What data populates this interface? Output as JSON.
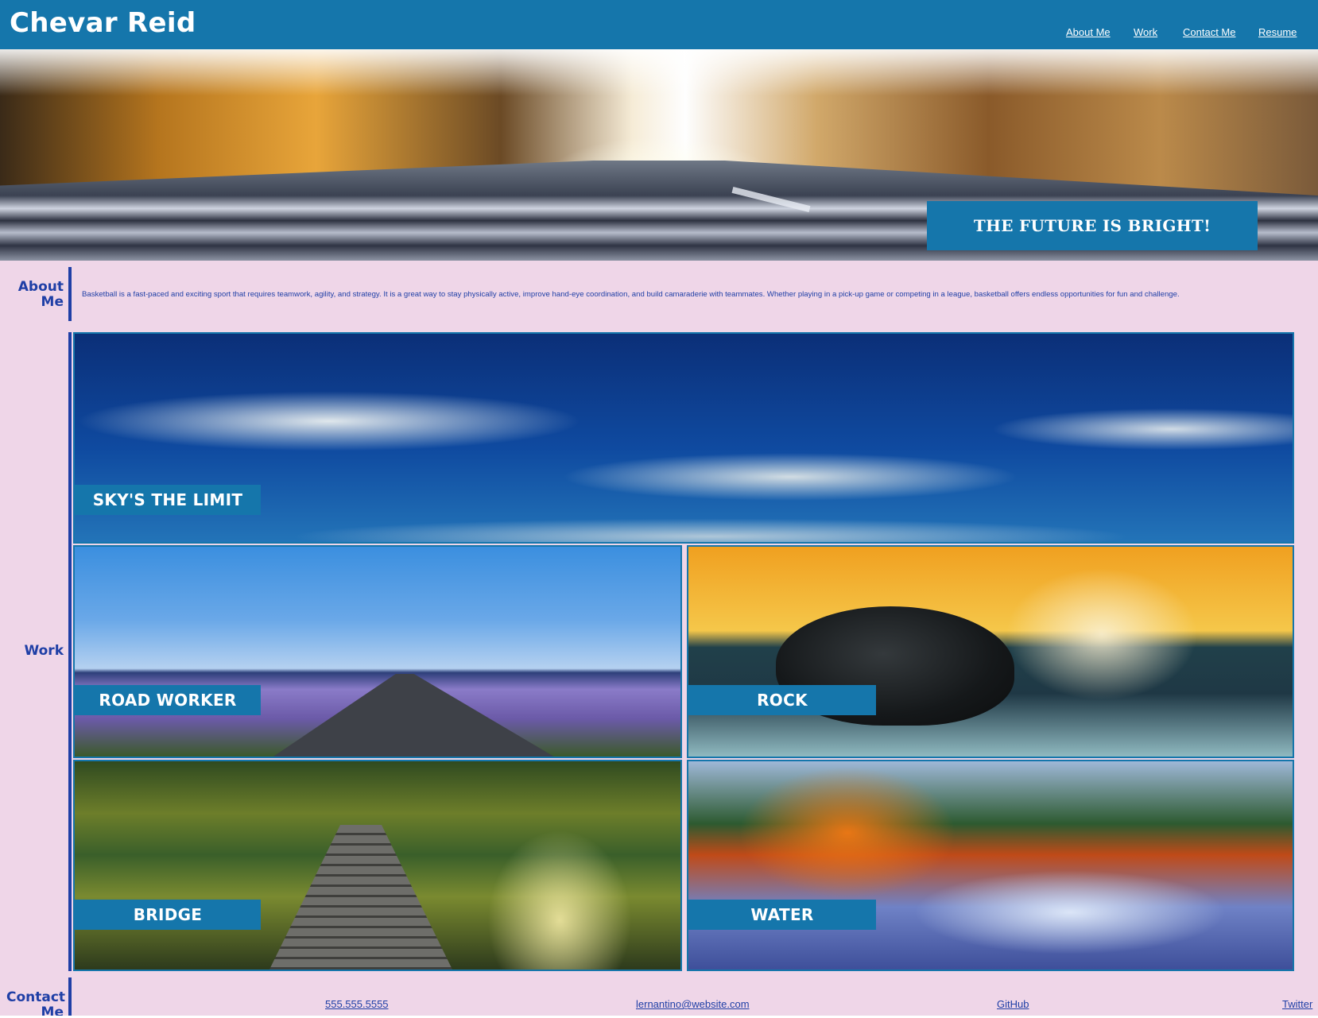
{
  "header": {
    "title": "Chevar Reid",
    "nav": [
      "About Me",
      "Work",
      "Contact Me",
      "Resume"
    ]
  },
  "hero": {
    "banner": "THE FUTURE IS BRIGHT!"
  },
  "about": {
    "heading": "About Me",
    "text": "Basketball is a fast-paced and exciting sport that requires teamwork, agility, and strategy. It is a great way to stay physically active, improve hand-eye coordination, and build camaraderie with teammates. Whether playing in a pick-up game or competing in a league, basketball offers endless opportunities for fun and challenge."
  },
  "work": {
    "heading": "Work",
    "tiles": [
      {
        "label": "SKY'S THE LIMIT"
      },
      {
        "label": "ROAD WORKER"
      },
      {
        "label": "ROCK"
      },
      {
        "label": "BRIDGE"
      },
      {
        "label": "WATER"
      }
    ]
  },
  "contact": {
    "heading": "Contact Me",
    "phone": "555.555.5555",
    "email": "lernantino@website.com",
    "github": "GitHub",
    "twitter": "Twitter"
  },
  "colors": {
    "header_bg": "#1576ab",
    "page_bg": "#efd6e8",
    "text": "#1f3fa6"
  }
}
